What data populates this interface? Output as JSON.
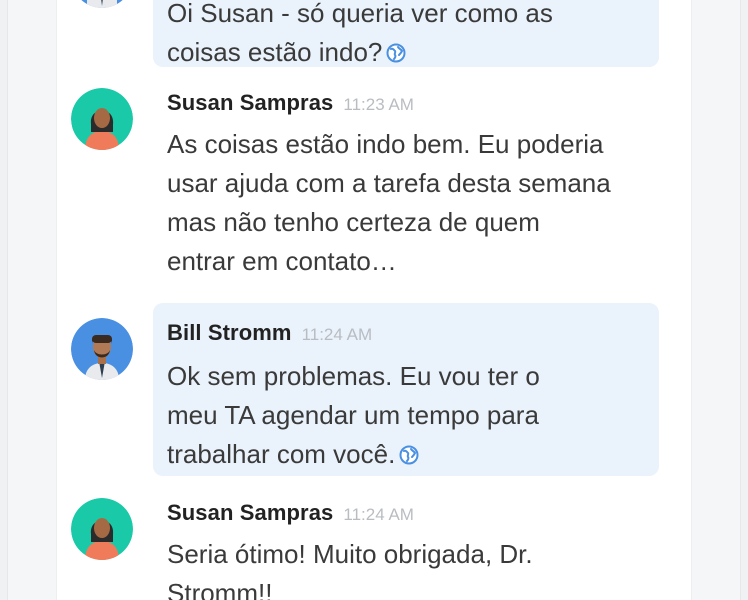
{
  "messages": [
    {
      "author": "",
      "time": "",
      "lines": [
        "Oi Susan - só queria ver como as",
        "coisas estão indo?"
      ],
      "translated": true
    },
    {
      "author": "Susan Sampras",
      "time": "11:23 AM",
      "lines": [
        "As coisas estão indo bem. Eu poderia",
        "usar ajuda com a tarefa desta semana",
        "mas não tenho certeza de quem",
        "entrar em contato…"
      ],
      "translated": false
    },
    {
      "author": "Bill Stromm",
      "time": "11:24 AM",
      "lines": [
        "Ok sem problemas. Eu vou ter o",
        "meu TA agendar um tempo para",
        "trabalhar com você."
      ],
      "translated": true
    },
    {
      "author": "Susan Sampras",
      "time": "11:24 AM",
      "lines": [
        "Seria ótimo! Muito obrigada, Dr.",
        "Stromm!!"
      ],
      "translated": false
    }
  ],
  "colors": {
    "bubble": "#eaf2fb",
    "susan_avatar_bg": "#19c9a8",
    "bill_avatar_bg": "#4a90e2",
    "globe": "#4a90e2"
  },
  "icons": {
    "translate": "globe-icon",
    "susan": "avatar-susan",
    "bill": "avatar-bill"
  }
}
